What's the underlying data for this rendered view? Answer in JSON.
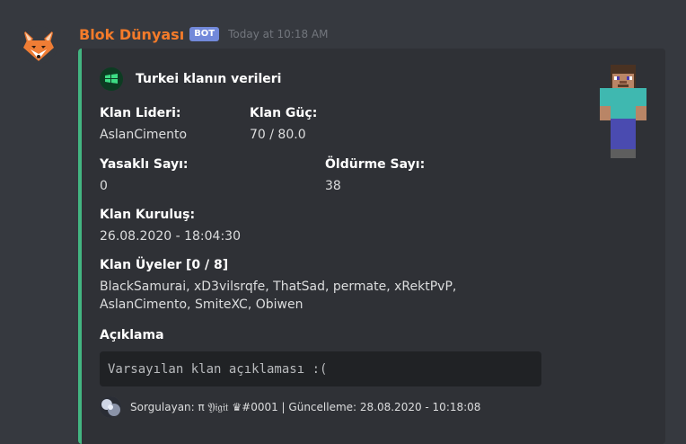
{
  "message": {
    "username": "Blok Dünyası",
    "bot_tag": "BOT",
    "timestamp": "Today at 10:18 AM"
  },
  "embed": {
    "accent_color": "#43b581",
    "author": "Turkei klanın verileri",
    "fields": {
      "leader": {
        "name": "Klan Lideri:",
        "value": "AslanCimento"
      },
      "power": {
        "name": "Klan Güç:",
        "value": "70 / 80.0"
      },
      "banned": {
        "name": "Yasaklı Sayı:",
        "value": "0"
      },
      "kills": {
        "name": "Öldürme Sayı:",
        "value": "38"
      },
      "founded": {
        "name": "Klan Kuruluş:",
        "value": "26.08.2020 - 18:04:30"
      },
      "members": {
        "name": "Klan Üyeler [0 / 8]",
        "line1": "BlackSamurai, xD3vilsrqfe, ThatSad, permate, xRektPvP,",
        "line2": "AslanCimento, SmiteXC, Obiwen"
      },
      "description": {
        "name": "Açıklama",
        "value": "Varsayılan klan açıklaması :("
      }
    },
    "footer": "Sorgulayan: π 𝔜𝔦𝔤𝔦𝔱 ♛#0001 | Güncelleme: 28.08.2020 - 10:18:08"
  }
}
